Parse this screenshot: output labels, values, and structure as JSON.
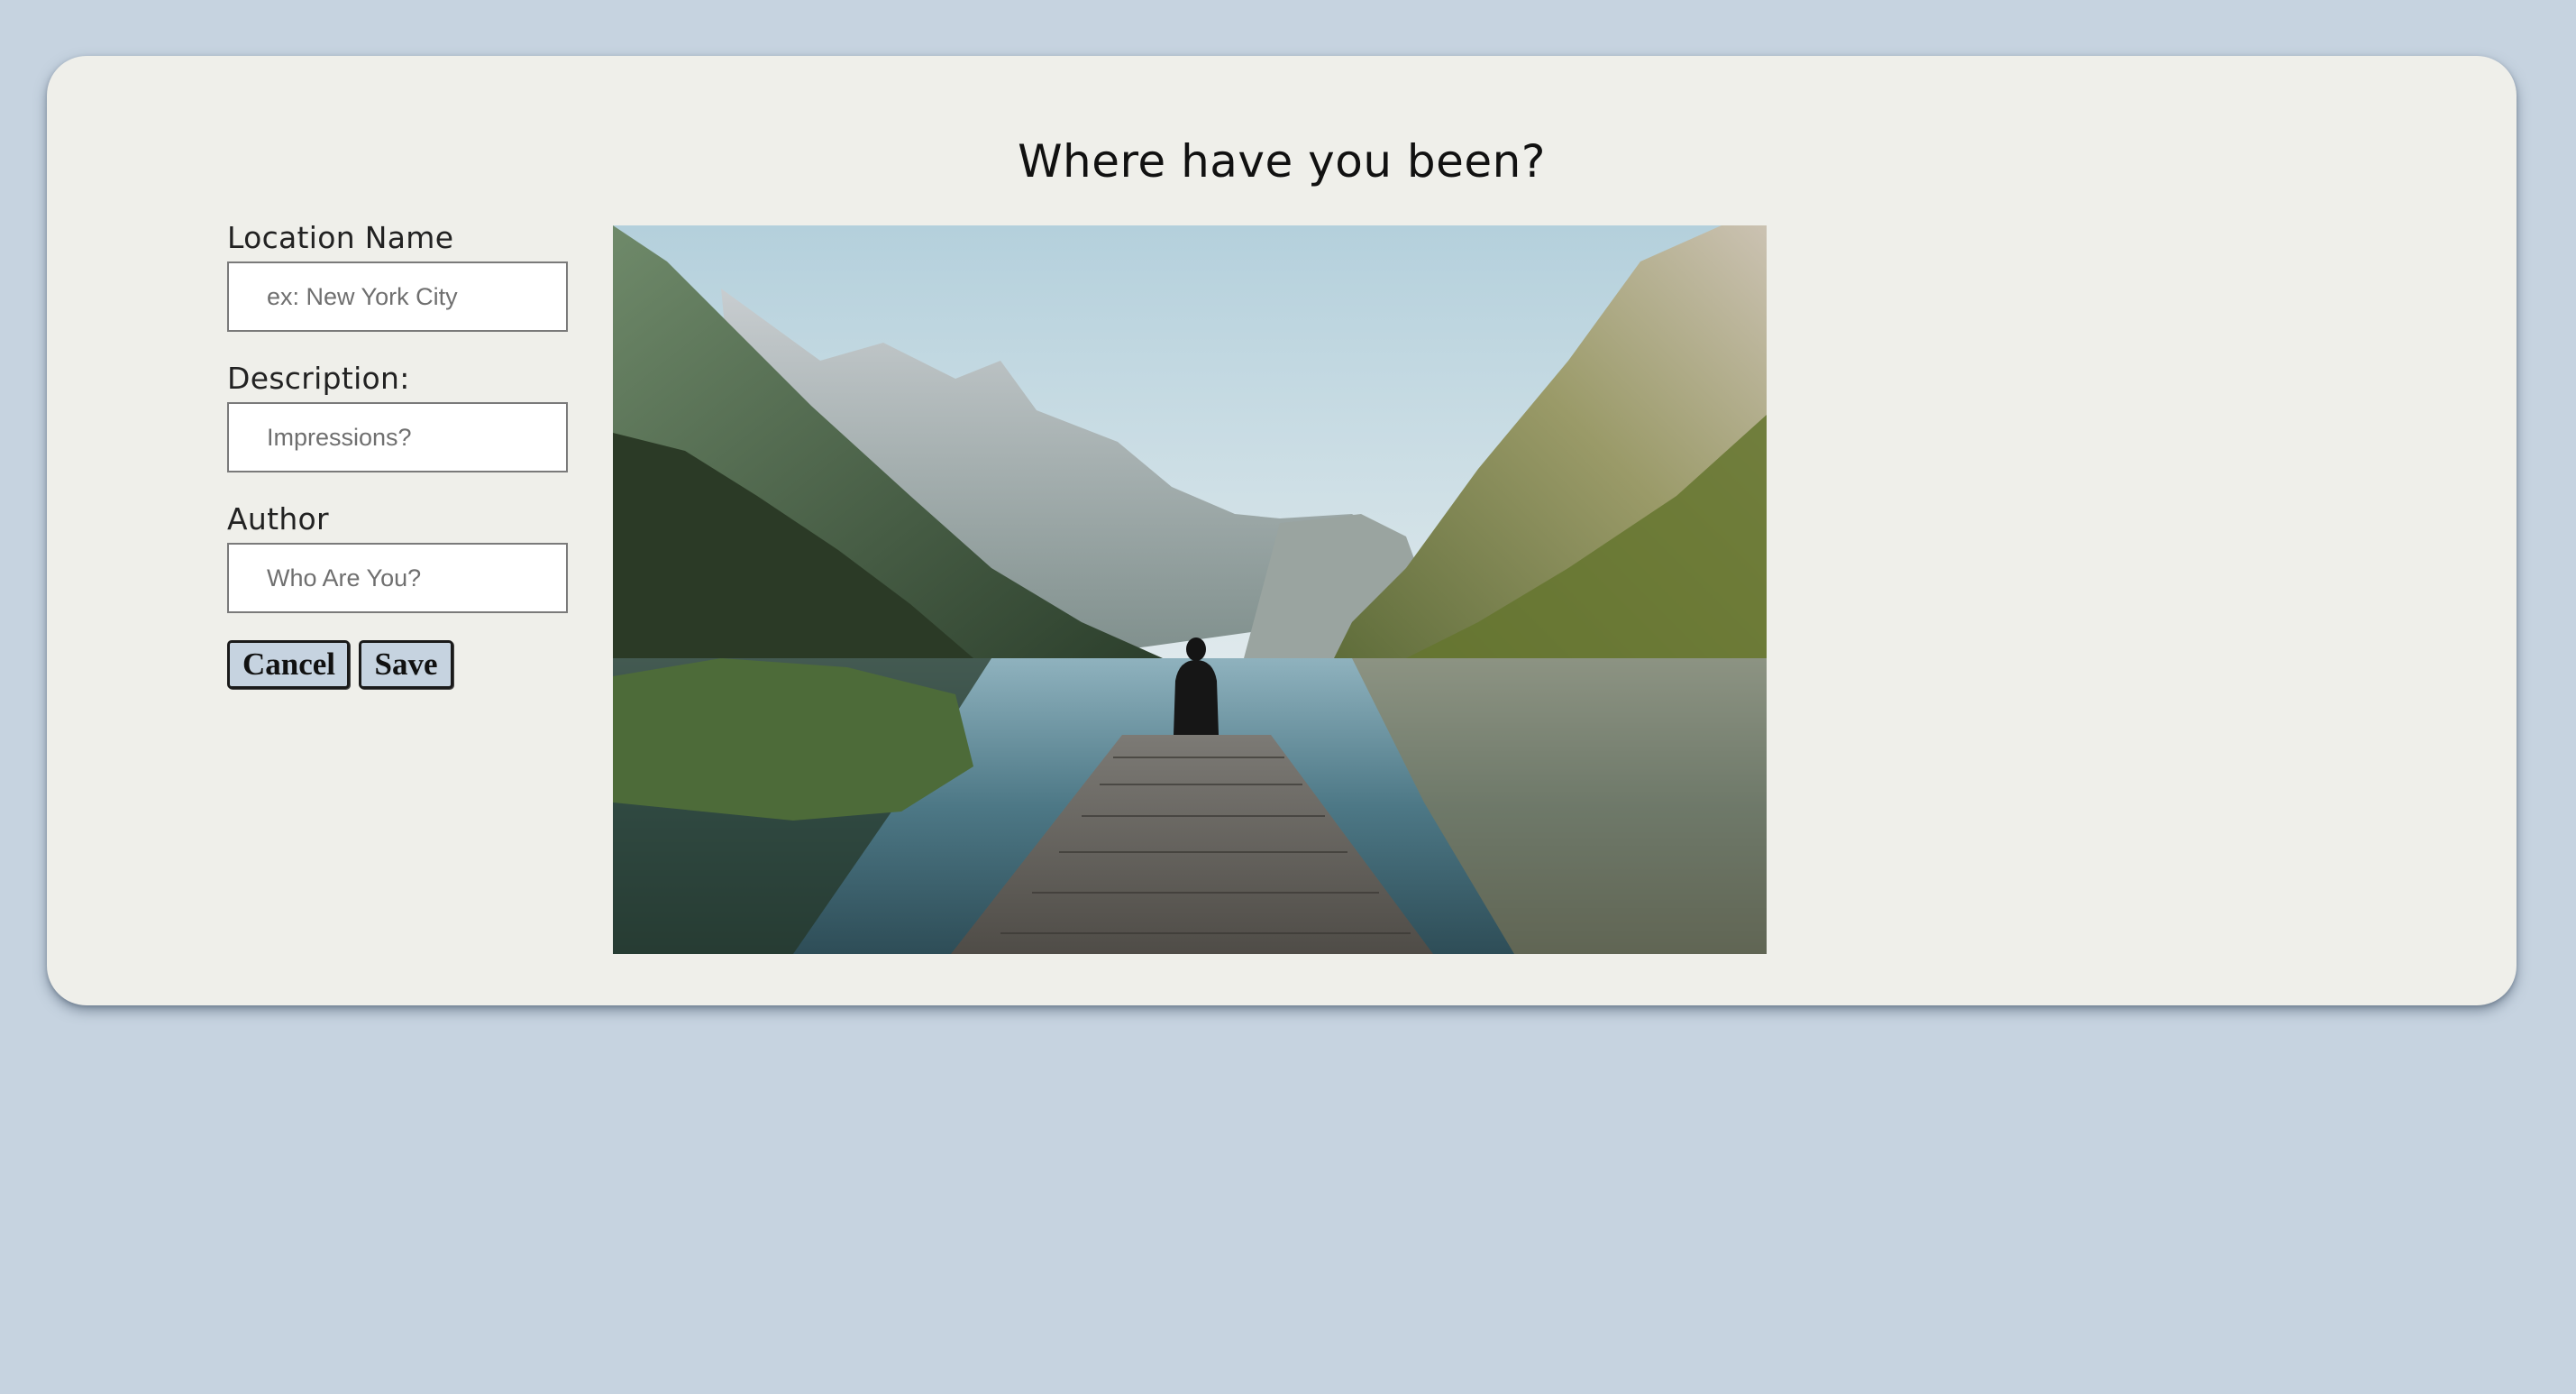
{
  "page": {
    "title": "Where have you been?"
  },
  "form": {
    "location": {
      "label": "Location Name",
      "placeholder": "ex: New York City",
      "value": ""
    },
    "description": {
      "label": "Description:",
      "placeholder": "Impressions?",
      "value": ""
    },
    "author": {
      "label": "Author",
      "placeholder": "Who Are You?",
      "value": ""
    },
    "buttons": {
      "cancel_label": "Cancel",
      "save_label": "Save"
    }
  },
  "image": {
    "subject": "landscape-photo"
  },
  "colors": {
    "background": "#c6d3e0",
    "card": "#efefea",
    "button": "#c6d3e0"
  }
}
